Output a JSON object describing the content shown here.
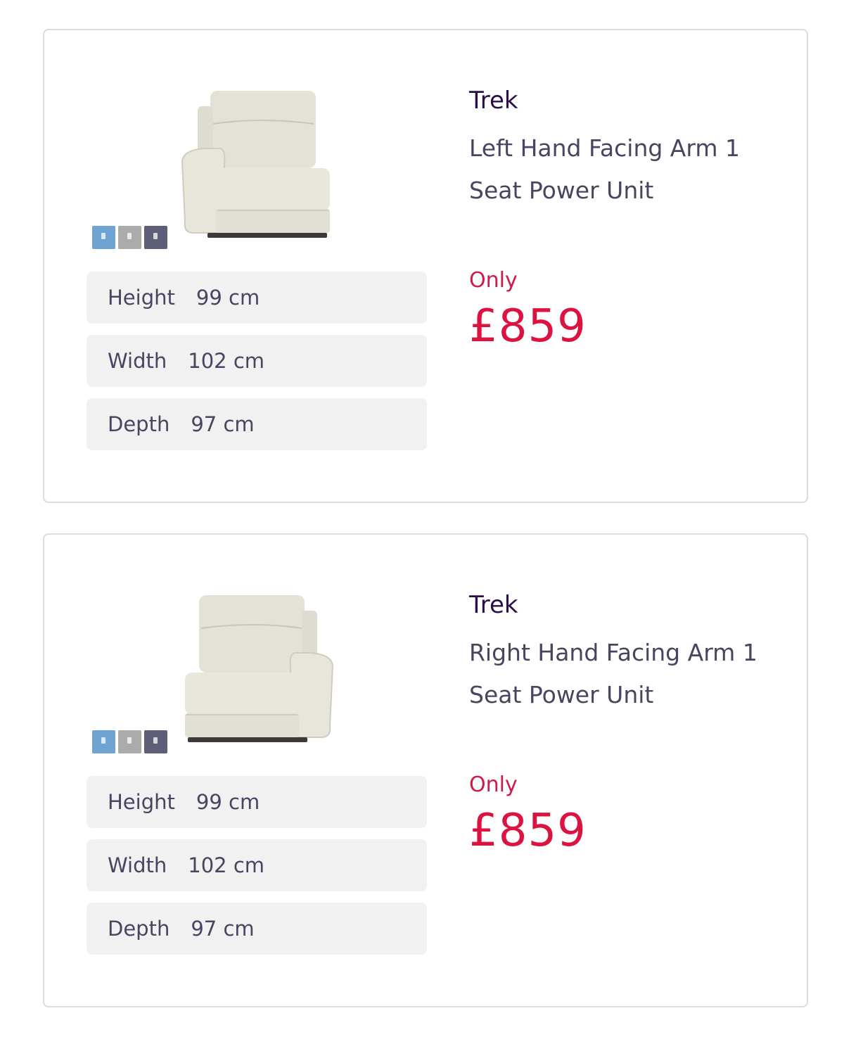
{
  "products": [
    {
      "brand": "Trek",
      "title": "Left Hand Facing Arm 1 Seat Power Unit",
      "orientation": "left",
      "swatches": [
        "blue",
        "grey",
        "slate"
      ],
      "dimensions": [
        {
          "label": "Height",
          "value": "99 cm"
        },
        {
          "label": "Width",
          "value": "102 cm"
        },
        {
          "label": "Depth",
          "value": "97 cm"
        }
      ],
      "price_prefix": "Only",
      "price": "£859"
    },
    {
      "brand": "Trek",
      "title": "Right Hand Facing Arm 1 Seat Power Unit",
      "orientation": "right",
      "swatches": [
        "blue",
        "grey",
        "slate"
      ],
      "dimensions": [
        {
          "label": "Height",
          "value": "99 cm"
        },
        {
          "label": "Width",
          "value": "102 cm"
        },
        {
          "label": "Depth",
          "value": "97 cm"
        }
      ],
      "price_prefix": "Only",
      "price": "£859"
    }
  ],
  "colors": {
    "brand_text": "#2b0d4a",
    "price": "#dc1340",
    "body_text": "#4a4460",
    "dimension_bg": "#f1f1f1"
  }
}
